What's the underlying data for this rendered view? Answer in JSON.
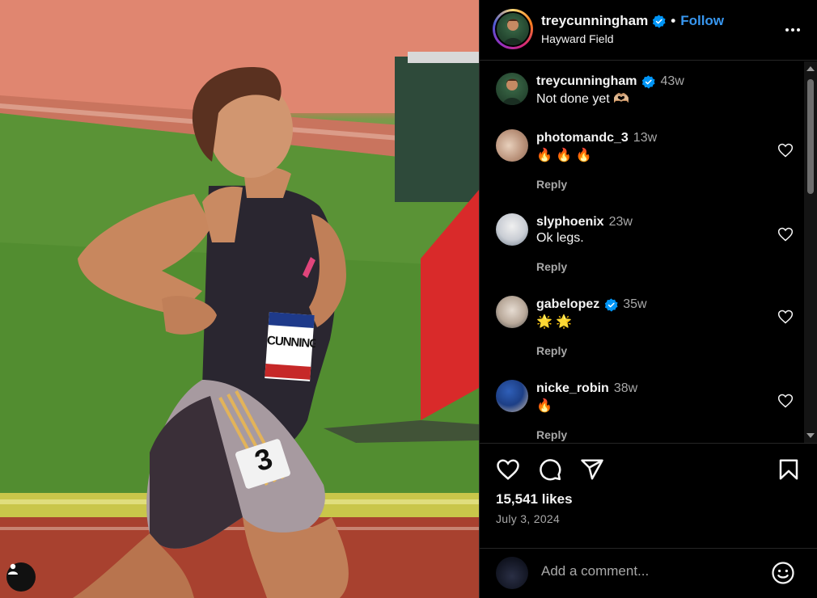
{
  "post": {
    "username": "treycunningham",
    "verified": true,
    "follow_label": "Follow",
    "separator": "•",
    "location": "Hayward Field",
    "likes": "15,541 likes",
    "date": "July 3, 2024"
  },
  "caption": {
    "username": "treycunningham",
    "time": "43w",
    "text": "Not done yet 🫶🏼"
  },
  "comments": [
    {
      "username": "photomandc_3",
      "verified": false,
      "time": "13w",
      "text": "🔥 🔥 🔥",
      "reply_label": "Reply"
    },
    {
      "username": "slyphoenix",
      "verified": false,
      "time": "23w",
      "text": "Ok legs.",
      "reply_label": "Reply"
    },
    {
      "username": "gabelopez",
      "verified": true,
      "time": "35w",
      "text": "🌟 🌟",
      "reply_label": "Reply"
    },
    {
      "username": "nicke_robin",
      "verified": false,
      "time": "38w",
      "text": "🔥",
      "reply_label": "Reply"
    }
  ],
  "photo": {
    "bib_name": "CUNNINGH",
    "hip_number": "3"
  },
  "comment_box": {
    "placeholder": "Add a comment..."
  },
  "colors": {
    "background": "#000000",
    "accent_blue": "#0095f6",
    "muted_text": "#a8a8a8",
    "divider": "#262626"
  },
  "icons": [
    "verified-badge-icon",
    "more-options-icon",
    "heart-icon",
    "comment-icon",
    "share-icon",
    "bookmark-icon",
    "emoji-icon",
    "user-icon"
  ]
}
